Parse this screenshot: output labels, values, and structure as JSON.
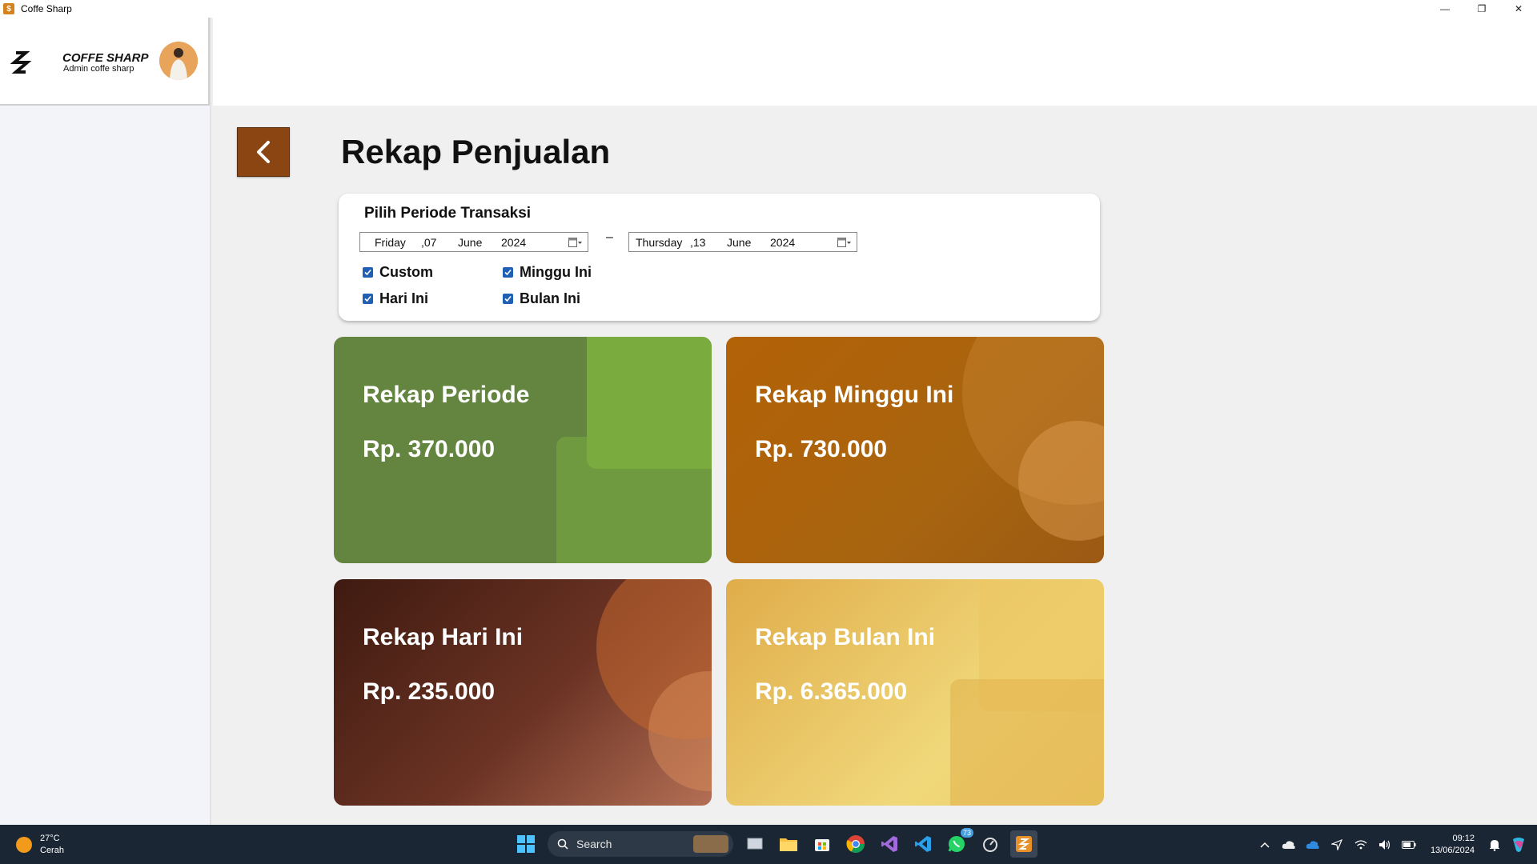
{
  "window": {
    "title": "Coffe Sharp",
    "minimize": "—",
    "maximize": "❐",
    "close": "✕"
  },
  "sidebar": {
    "brand_name": "COFFE SHARP",
    "brand_sub": "Admin coffe sharp"
  },
  "page": {
    "title": "Rekap Penjualan"
  },
  "filter": {
    "title": "Pilih Periode Transaksi",
    "start": {
      "day": "Friday",
      "date": ",07",
      "month": "June",
      "year": "2024"
    },
    "separator": "–",
    "end": {
      "day": "Thursday",
      "date": ",13",
      "month": "June",
      "year": "2024"
    },
    "options": [
      {
        "label": "Custom",
        "checked": true
      },
      {
        "label": "Minggu Ini",
        "checked": true
      },
      {
        "label": "Hari Ini",
        "checked": true
      },
      {
        "label": "Bulan Ini",
        "checked": true
      }
    ]
  },
  "cards": [
    {
      "label": "Rekap Periode",
      "value": "Rp. 370.000",
      "color": "#648540"
    },
    {
      "label": "Rekap Minggu Ini",
      "value": "Rp. 730.000",
      "color": "#b36207"
    },
    {
      "label": "Rekap Hari Ini",
      "value": "Rp. 235.000",
      "color": "#4f2418"
    },
    {
      "label": "Rekap Bulan Ini",
      "value": "Rp. 6.365.000",
      "color": "#e8bd58"
    }
  ],
  "taskbar": {
    "weather_temp": "27°C",
    "weather_desc": "Cerah",
    "search_label": "Search",
    "whatsapp_badge": "73",
    "time": "09:12",
    "date": "13/06/2024"
  }
}
